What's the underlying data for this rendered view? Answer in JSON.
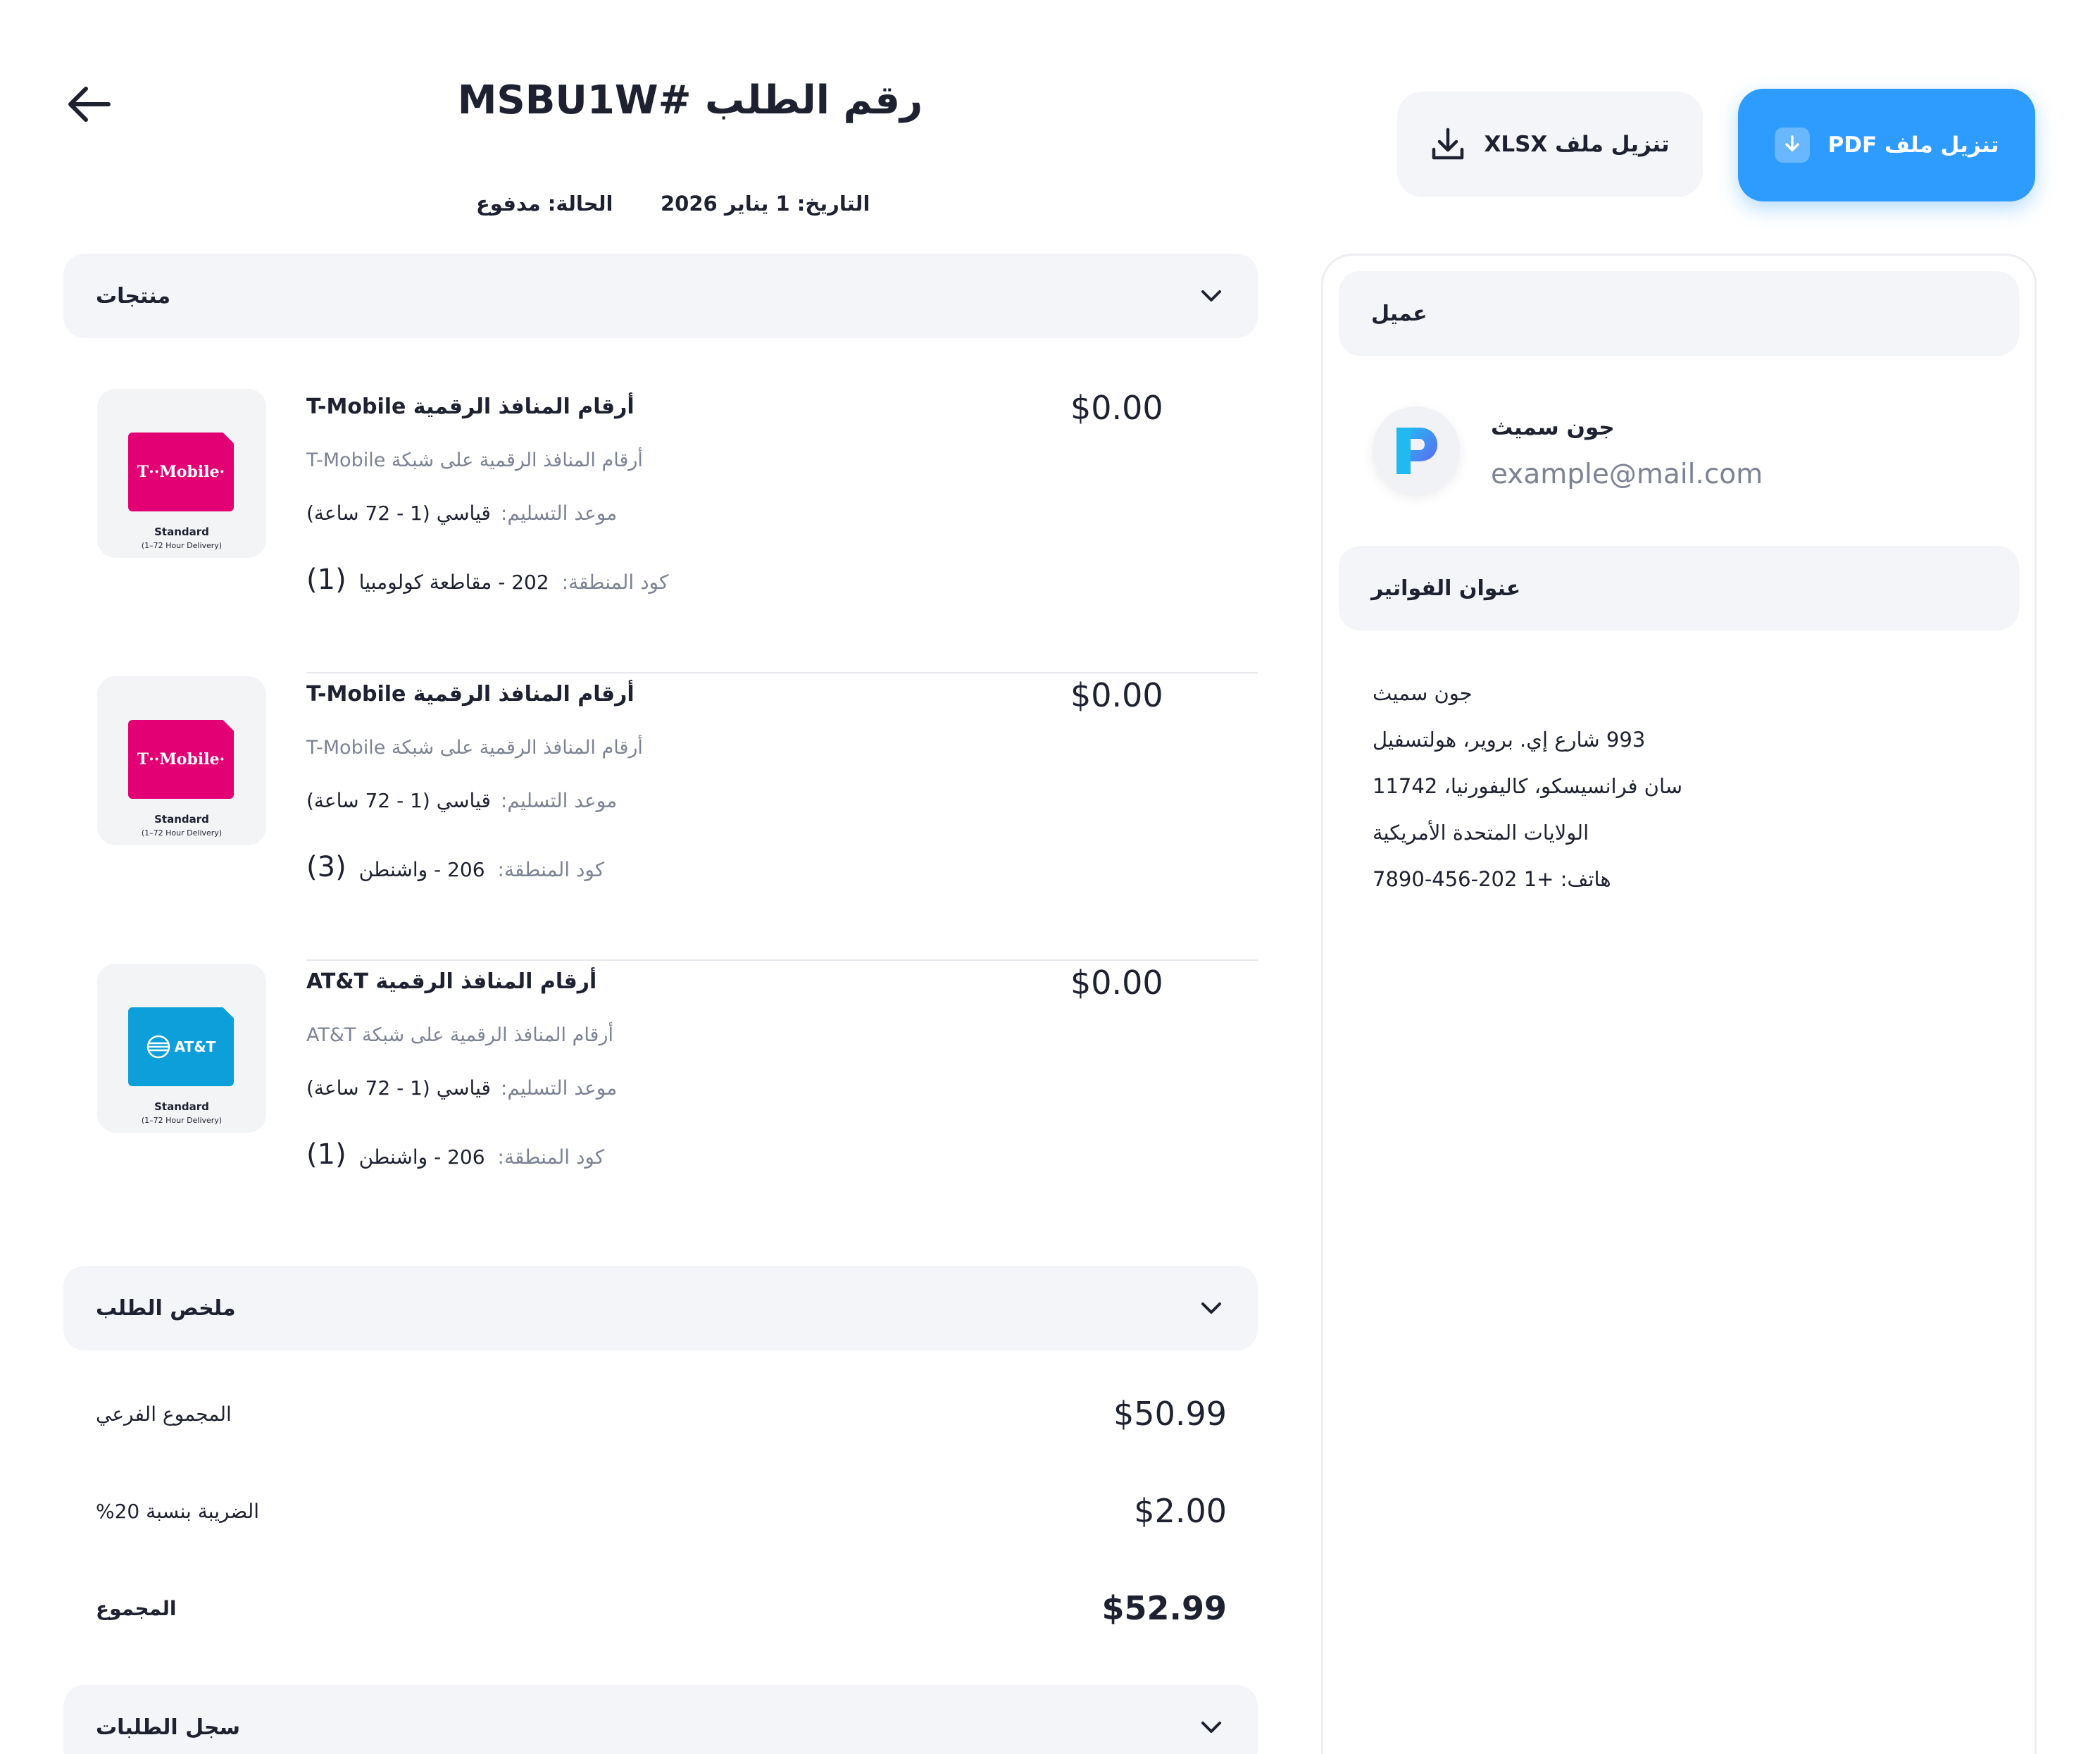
{
  "header": {
    "title": "رقم الطلب #MSBU1W",
    "date": "التاريخ: 1 يناير 2026",
    "status": "الحالة: مدفوع",
    "download_xlsx": "تنزيل ملف XLSX",
    "download_pdf": "تنزيل ملف PDF"
  },
  "products_section": {
    "label": "منتجات"
  },
  "products": [
    {
      "title": "أرقام المنافذ الرقمية T-Mobile",
      "description": "أرقام المنافذ الرقمية على شبكة T-Mobile",
      "delivery_label": "موعد التسليم:",
      "delivery_value": "قياسي (1 - 72 ساعة)",
      "area_label": "كود المنطقة:",
      "area_value": "202 - مقاطعة كولومبيا",
      "quantity": "(1)",
      "price": "$0.00",
      "brand": "T··Mobile·",
      "thumb_label": "Standard",
      "thumb_sub": "(1–72 Hour Delivery)"
    },
    {
      "title": "أرقام المنافذ الرقمية T-Mobile",
      "description": "أرقام المنافذ الرقمية على شبكة T-Mobile",
      "delivery_label": "موعد التسليم:",
      "delivery_value": "قياسي (1 - 72 ساعة)",
      "area_label": "كود المنطقة:",
      "area_value": "206 - واشنطن",
      "quantity": "(3)",
      "price": "$0.00",
      "brand": "T··Mobile·",
      "thumb_label": "Standard",
      "thumb_sub": "(1–72 Hour Delivery)"
    },
    {
      "title": "أرقام المنافذ الرقمية AT&T",
      "description": "أرقام المنافذ الرقمية على شبكة AT&T",
      "delivery_label": "موعد التسليم:",
      "delivery_value": "قياسي (1 - 72 ساعة)",
      "area_label": "كود المنطقة:",
      "area_value": "206 - واشنطن",
      "quantity": "(1)",
      "price": "$0.00",
      "brand": "AT&T",
      "thumb_label": "Standard",
      "thumb_sub": "(1–72 Hour Delivery)"
    }
  ],
  "summary_section": {
    "label": "ملخص الطلب"
  },
  "summary": {
    "subtotal_label": "المجموع الفرعي",
    "subtotal_value": "$50.99",
    "tax_label": "الضريبة بنسبة 20%",
    "tax_value": "$2.00",
    "total_label": "المجموع",
    "total_value": "$52.99"
  },
  "history_section": {
    "label": "سجل الطلبات"
  },
  "customer": {
    "section_label": "عميل",
    "name": "جون سميث",
    "email": "example@mail.com"
  },
  "billing": {
    "section_label": "عنوان الفواتير",
    "lines": [
      "جون سميث",
      "993 شارع إي. بروير، هولتسفيل",
      "سان فرانسيسكو، كاليفورنيا، 11742",
      "الولايات المتحدة الأمريكية",
      "هاتف: +1 202-456-7890"
    ]
  },
  "colors": {
    "accent": "#2e9bff",
    "tmobile": "#e20074",
    "att": "#0d9fd9",
    "bar": "#f4f5f8",
    "muted_text": "#7c8393"
  },
  "icons": [
    "arrow-left-icon",
    "download-icon",
    "chevron-down-icon",
    "brand-logo-icon"
  ]
}
